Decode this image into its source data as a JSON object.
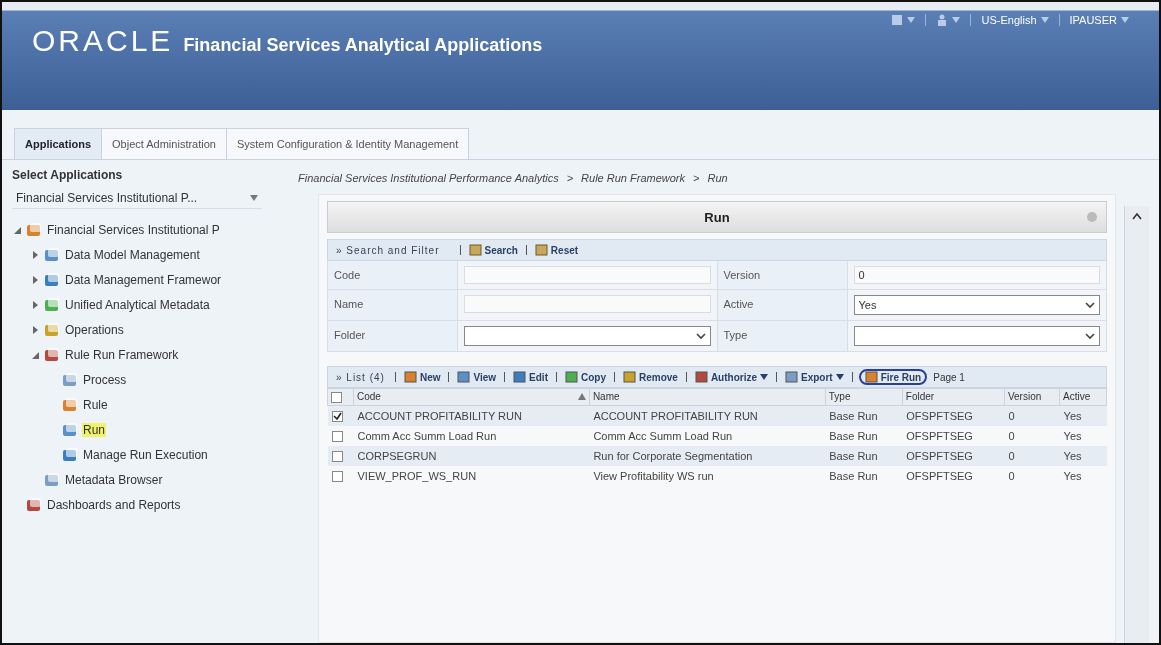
{
  "header": {
    "brand": "ORACLE",
    "product": "Financial Services Analytical Applications",
    "menus": [
      {
        "kind": "icon"
      },
      {
        "kind": "icon"
      },
      {
        "kind": "text",
        "label": "US-English"
      },
      {
        "kind": "text",
        "label": "IPAUSER"
      }
    ]
  },
  "tabs": [
    {
      "label": "Applications",
      "selected": true
    },
    {
      "label": "Object Administration",
      "selected": false
    },
    {
      "label": "System Configuration & Identity Management",
      "selected": false
    }
  ],
  "sidebar": {
    "title": "Select Applications",
    "application": "Financial Services Institutional P...",
    "tree": [
      {
        "label": "Financial Services Institutional P",
        "expanded": true,
        "selected": false,
        "children": [
          {
            "label": "Data Model Management",
            "expanded": false,
            "selected": false
          },
          {
            "label": "Data Management Framewor",
            "expanded": false,
            "selected": false
          },
          {
            "label": "Unified Analytical Metadata",
            "expanded": false,
            "selected": false
          },
          {
            "label": "Operations",
            "expanded": false,
            "selected": false
          },
          {
            "label": "Rule Run Framework",
            "expanded": true,
            "selected": false,
            "children": [
              {
                "label": "Process",
                "selected": false
              },
              {
                "label": "Rule",
                "selected": false
              },
              {
                "label": "Run",
                "selected": true
              },
              {
                "label": "Manage Run Execution",
                "selected": false
              }
            ]
          },
          {
            "label": "Metadata Browser",
            "selected": false
          }
        ]
      },
      {
        "label": "Dashboards and Reports",
        "selected": false
      }
    ]
  },
  "breadcrumb": {
    "separator": ">",
    "items": [
      "Financial Services Institutional Performance Analytics",
      "Rule Run Framework",
      "Run"
    ]
  },
  "panel_title": "Run",
  "search": {
    "title": "» Search and Filter",
    "actions": [
      "Search",
      "Reset"
    ],
    "fields": [
      {
        "label": "Code",
        "kind": "text"
      },
      {
        "label": "Version",
        "kind": "text",
        "value": "0"
      },
      {
        "label": "Name",
        "kind": "text"
      },
      {
        "label": "Active",
        "kind": "select",
        "value": "Yes"
      },
      {
        "label": "Folder",
        "kind": "select"
      },
      {
        "label": "Type",
        "kind": "select"
      }
    ]
  },
  "list": {
    "title": "» List (4)",
    "toolbar": [
      {
        "label": "New",
        "dropdown": false,
        "circled": false
      },
      {
        "label": "View",
        "dropdown": false,
        "circled": false
      },
      {
        "label": "Edit",
        "dropdown": false,
        "circled": false
      },
      {
        "label": "Copy",
        "dropdown": false,
        "circled": false
      },
      {
        "label": "Remove",
        "dropdown": false,
        "circled": false
      },
      {
        "label": "Authorize",
        "dropdown": true,
        "circled": false
      },
      {
        "label": "Export",
        "dropdown": true,
        "circled": false
      },
      {
        "label": "Fire Run",
        "dropdown": false,
        "circled": true
      }
    ],
    "page": "Page 1",
    "all_checked": false,
    "columns": [
      "Code",
      "Name",
      "Type",
      "Folder",
      "Version",
      "Active"
    ],
    "rows": [
      {
        "checked": true,
        "cells": [
          "ACCOUNT PROFITABILITY RUN",
          "ACCOUNT PROFITABILITY RUN",
          "Base Run",
          "OFSPFTSEG",
          "0",
          "Yes"
        ]
      },
      {
        "checked": false,
        "cells": [
          "Comm Acc Summ Load Run",
          "Comm Acc Summ Load Run",
          "Base Run",
          "OFSPFTSEG",
          "0",
          "Yes"
        ]
      },
      {
        "checked": false,
        "cells": [
          "CORPSEGRUN",
          "Run for Corporate Segmentation",
          "Base Run",
          "OFSPFTSEG",
          "0",
          "Yes"
        ]
      },
      {
        "checked": false,
        "cells": [
          "VIEW_PROF_WS_RUN",
          "View Profitability WS run",
          "Base Run",
          "OFSPFTSEG",
          "0",
          "Yes"
        ]
      }
    ]
  }
}
